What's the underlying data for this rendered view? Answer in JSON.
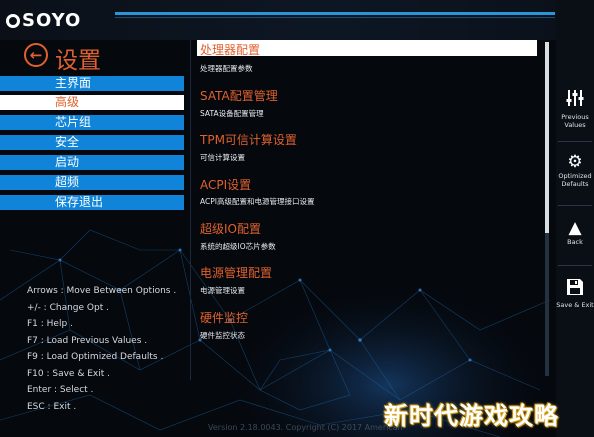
{
  "brand": {
    "logo_text": "SOYO"
  },
  "header": {
    "title": "设置"
  },
  "nav": {
    "items": [
      {
        "label": "主界面"
      },
      {
        "label": "高级"
      },
      {
        "label": "芯片组"
      },
      {
        "label": "安全"
      },
      {
        "label": "启动"
      },
      {
        "label": "超频"
      },
      {
        "label": "保存退出"
      }
    ],
    "selected_index": 1
  },
  "help": {
    "lines": [
      "Arrows : Move Between Options .",
      "+/- : Change Opt .",
      "F1 : Help .",
      "F7 : Load Previous Values .",
      "F9 : Load Optimized Defaults .",
      "F10 : Save & Exit .",
      "Enter : Select .",
      "ESC : Exit ."
    ]
  },
  "options": [
    {
      "title": "处理器配置",
      "desc": "处理器配置参数"
    },
    {
      "title": "SATA配置管理",
      "desc": "SATA设备配置管理"
    },
    {
      "title": "TPM可信计算设置",
      "desc": "可信计算设置"
    },
    {
      "title": "ACPI设置",
      "desc": "ACPI高级配置和电源管理接口设置"
    },
    {
      "title": "超级IO配置",
      "desc": "系统的超级IO芯片参数"
    },
    {
      "title": "电源管理配置",
      "desc": "电源管理设置"
    },
    {
      "title": "硬件监控",
      "desc": "硬件监控状态"
    }
  ],
  "right_panel": {
    "buttons": [
      {
        "label1": "Previous",
        "label2": "Values",
        "icon": "sliders-icon"
      },
      {
        "label1": "Optimized",
        "label2": "Defaults",
        "icon": "gear-icon"
      },
      {
        "label1": "Back",
        "label2": "",
        "icon": "up-arrow-icon"
      },
      {
        "label1": "Save & Exit",
        "label2": "",
        "icon": "floppy-disk-icon"
      }
    ]
  },
  "footer": {
    "version": "Version 2.18.0043. Copyright (C) 2017 American"
  },
  "watermark": {
    "text": "新时代游戏攻略"
  },
  "colors": {
    "accent": "#e0612e",
    "nav_blue": "#0f84d8",
    "background": "#05080d"
  }
}
